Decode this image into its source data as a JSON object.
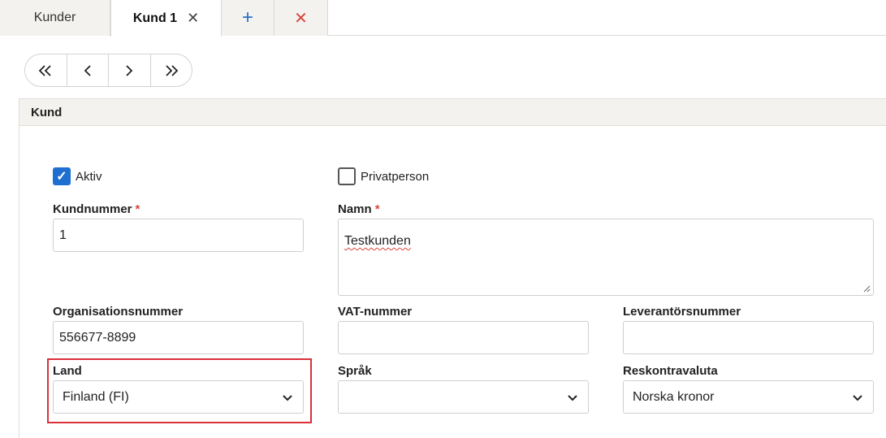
{
  "tabs": {
    "list_tab": "Kunder",
    "active_tab": "Kund 1",
    "add_glyph": "+",
    "close_glyph": "✕",
    "active_close_glyph": "✕"
  },
  "pager": {
    "first": "«",
    "prev": "‹",
    "next": "›",
    "last": "»"
  },
  "panel": {
    "title": "Kund"
  },
  "form": {
    "aktiv": {
      "label": "Aktiv",
      "checked": true
    },
    "privatperson": {
      "label": "Privatperson",
      "checked": false
    },
    "kundnummer": {
      "label": "Kundnummer",
      "required": "*",
      "value": "1"
    },
    "namn": {
      "label": "Namn",
      "required": "*",
      "value": "Testkunden"
    },
    "organisationsnummer": {
      "label": "Organisationsnummer",
      "value": "556677-8899"
    },
    "vat_nummer": {
      "label": "VAT-nummer",
      "value": ""
    },
    "leverantorsnummer": {
      "label": "Leverantörsnummer",
      "value": ""
    },
    "land": {
      "label": "Land",
      "value": "Finland (FI)"
    },
    "sprak": {
      "label": "Språk",
      "value": ""
    },
    "reskontravaluta": {
      "label": "Reskontravaluta",
      "value": "Norska kronor"
    }
  },
  "colors": {
    "accent": "#1f6fd1",
    "required": "#d9463e",
    "highlight": "#d9303a"
  }
}
